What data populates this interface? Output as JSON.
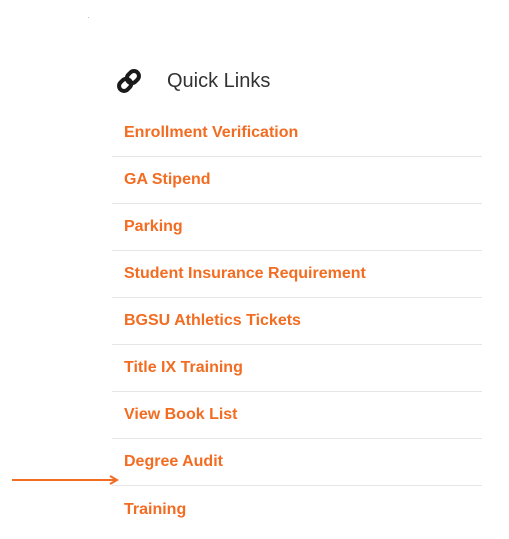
{
  "quick_links": {
    "title": "Quick Links",
    "icon": "link-icon",
    "items": [
      {
        "label": "Enrollment Verification"
      },
      {
        "label": "GA Stipend"
      },
      {
        "label": "Parking"
      },
      {
        "label": "Student Insurance Requirement"
      },
      {
        "label": "BGSU Athletics Tickets"
      },
      {
        "label": "Title IX Training"
      },
      {
        "label": "View Book List"
      },
      {
        "label": "Degree Audit"
      },
      {
        "label": "Training"
      }
    ],
    "annotation": {
      "icon": "arrow-right-icon",
      "points_to": "Degree Audit"
    }
  },
  "colors": {
    "link": "#f26c21",
    "title": "#333333",
    "divider": "#e6e6e6",
    "icon": "#1a1a1a",
    "arrow": "#f26c21"
  }
}
